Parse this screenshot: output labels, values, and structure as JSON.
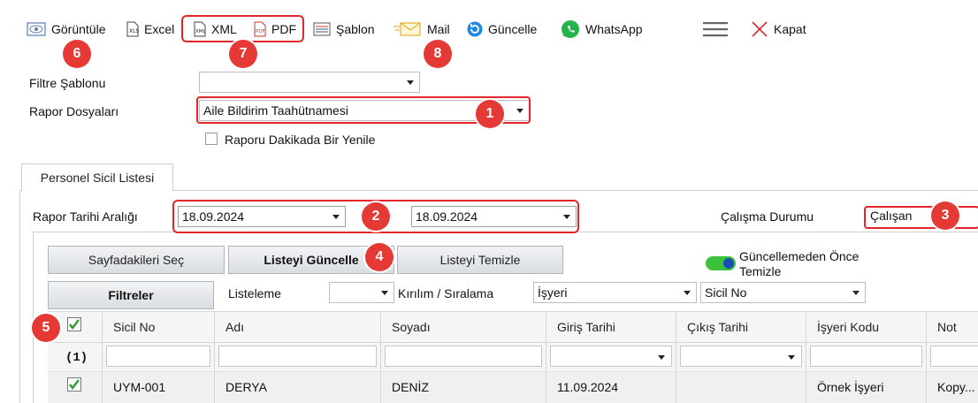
{
  "toolbar": {
    "items": [
      {
        "label": "Görüntüle",
        "icon": "eye-icon"
      },
      {
        "label": "Excel",
        "icon": "excel-file-icon"
      },
      {
        "label": "XML",
        "icon": "xml-file-icon"
      },
      {
        "label": "PDF",
        "icon": "pdf-file-icon"
      },
      {
        "label": "Şablon",
        "icon": "template-icon"
      },
      {
        "label": "Mail",
        "icon": "mail-icon"
      },
      {
        "label": "Güncelle",
        "icon": "refresh-icon"
      },
      {
        "label": "WhatsApp",
        "icon": "whatsapp-icon"
      },
      {
        "label": "",
        "icon": "hamburger-menu-icon"
      },
      {
        "label": "Kapat",
        "icon": "close-x-icon"
      }
    ]
  },
  "badges": [
    "1",
    "2",
    "3",
    "4",
    "5",
    "6",
    "7",
    "8"
  ],
  "form": {
    "filter_template_label": "Filtre Şablonu",
    "filter_template_value": "",
    "report_files_label": "Rapor Dosyaları",
    "report_files_value": "Aile Bildirim Taahütnamesi",
    "refresh_every_minute_label": "Raporu Dakikada Bir Yenile",
    "refresh_every_minute_checked": false
  },
  "tab": {
    "label": "Personel Sicil Listesi"
  },
  "report": {
    "date_range_label": "Rapor Tarihi Aralığı",
    "date_start": "18.09.2024",
    "date_end": "18.09.2024",
    "work_status_label": "Çalışma Durumu",
    "work_status_value": "Çalışan"
  },
  "actions": {
    "select_page": "Sayfadakileri Seç",
    "update_list": "Listeyi Güncelle",
    "clear_list": "Listeyi Temizle",
    "filters": "Filtreler",
    "clear_before_update_label": "Güncellemeden Önce Temizle",
    "clear_before_update_on": true,
    "listing_label": "Listeleme",
    "listing_value": "",
    "breakdown_label": "Kırılım / Sıralama",
    "breakdown_value": "İşyeri",
    "sort_value": "Sicil No"
  },
  "grid": {
    "columns": [
      "Sicil No",
      "Adı",
      "Soyadı",
      "Giriş Tarihi",
      "Çıkış Tarihi",
      "İşyeri Kodu",
      "Not"
    ],
    "count_label": "(1)",
    "rows": [
      {
        "checked": true,
        "cells": [
          "UYM-001",
          "DERYA",
          "DENİZ",
          "11.09.2024",
          "",
          "Örnek İşyeri",
          "Kopy..."
        ]
      }
    ]
  },
  "colors": {
    "accent_red": "#e2262b",
    "badge_red": "#e53935",
    "toggle_green": "#3cc13c",
    "check_green": "#2e9e2e"
  }
}
